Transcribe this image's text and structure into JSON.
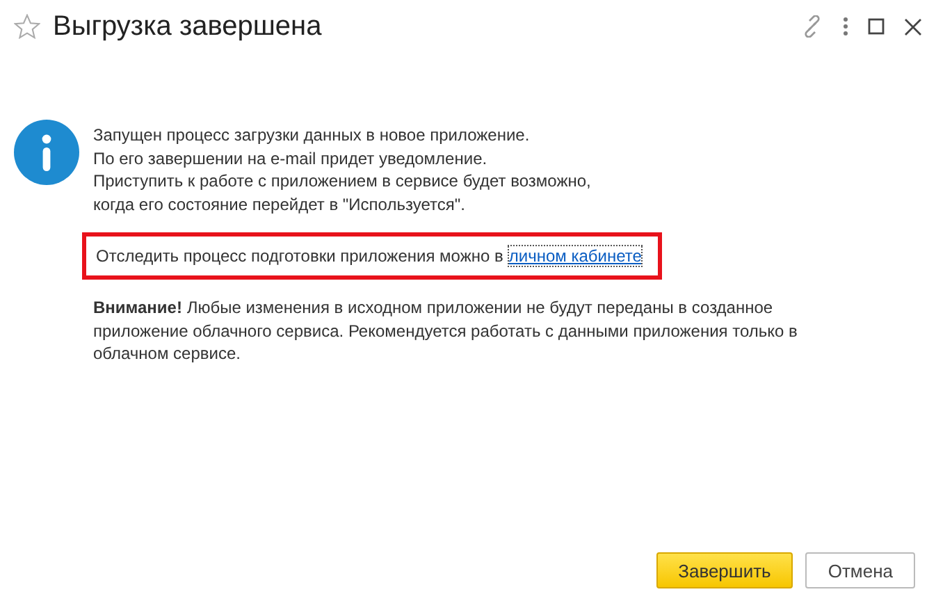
{
  "window": {
    "title": "Выгрузка завершена",
    "favorite": false
  },
  "message": {
    "lines": [
      "Запущен процесс загрузки данных в новое приложение.",
      "По его завершении на e-mail придет уведомление.",
      "Приступить к работе с приложением в сервисе будет возможно,",
      "когда его состояние перейдет в \"Используется\"."
    ],
    "tracking": {
      "text": "Отследить процесс подготовки приложения можно в",
      "link": "личном кабинете",
      "link_focused": true,
      "highlighted": true
    },
    "warning": "**Внимание!** Любые изменения в исходном приложении не будут переданы в созданное приложение облачного сервиса. Рекомендуется работать с данными приложения только в облачном сервисе."
  },
  "buttons": [
    {
      "label": "Завершить",
      "kind": "primary"
    },
    {
      "label": "Отмена",
      "kind": "secondary"
    }
  ]
}
